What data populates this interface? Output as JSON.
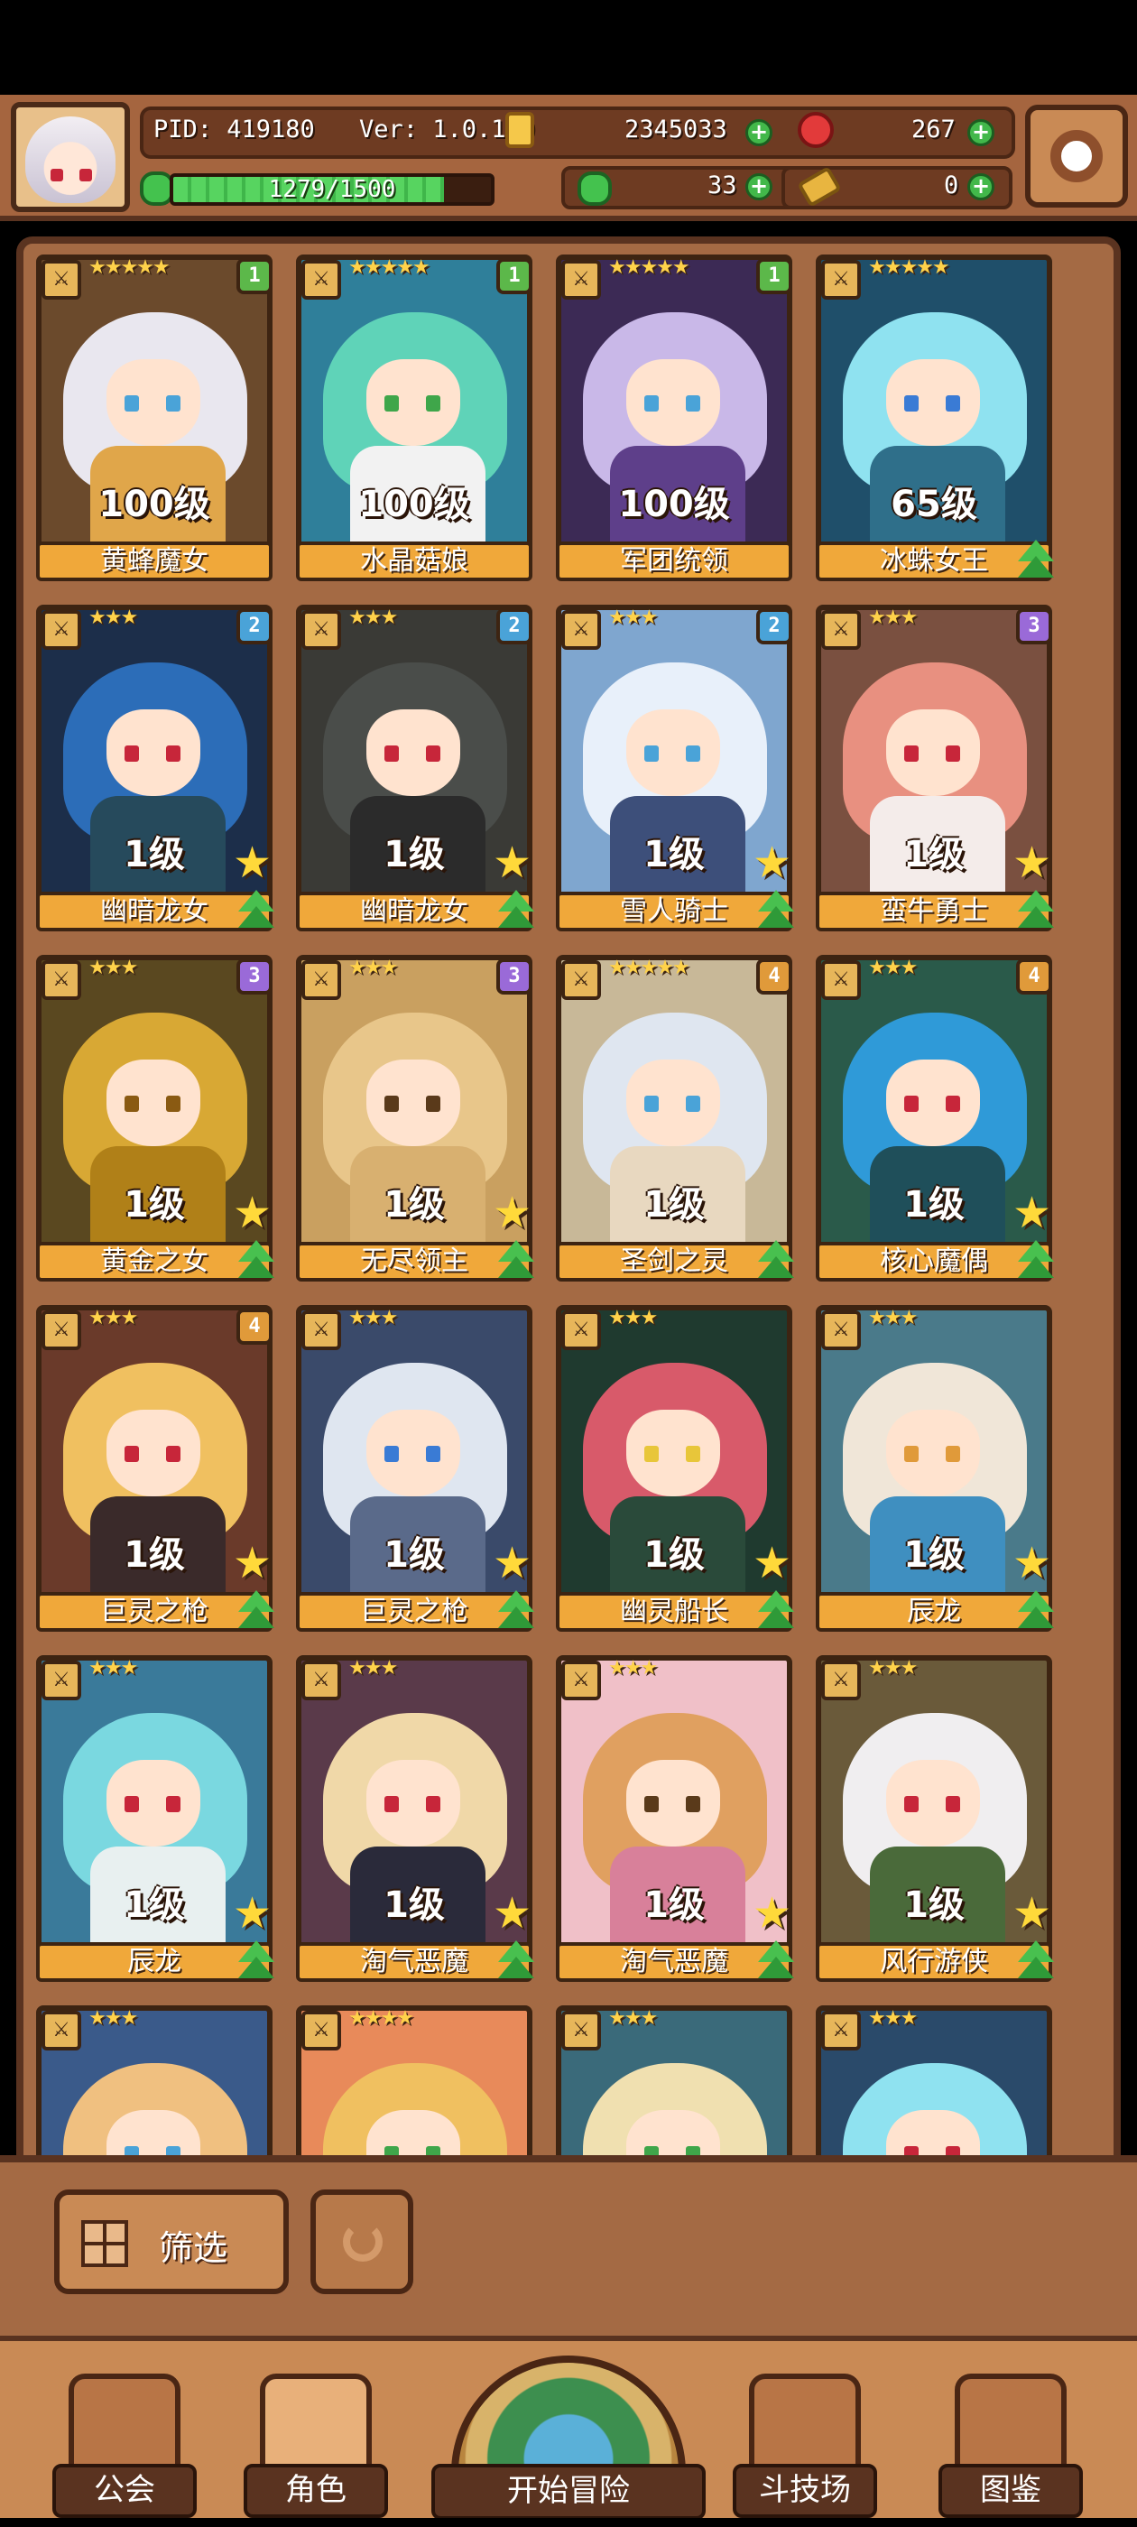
{
  "header": {
    "pid": "PID: 419180",
    "version": "Ver: 1.0.1.0",
    "gold": "2345033",
    "ruby": "267",
    "clover": "33",
    "keys": "0",
    "xp_text": "1279/1500",
    "xp_progress": 0.853
  },
  "cards": [
    {
      "name": "黄蜂魔女",
      "level": "100级",
      "stars": "★★★★★",
      "tier": "1",
      "tier_color": "#5cb84a",
      "hair": "#e9e7ef",
      "body": "#e0a64a",
      "bg": "#6b4a2c",
      "eye": "#4aa3d8",
      "show_star": false,
      "show_arrow": false
    },
    {
      "name": "水晶菇娘",
      "level": "100级",
      "stars": "★★★★★",
      "tier": "1",
      "tier_color": "#5cb84a",
      "hair": "#5fd3b8",
      "body": "#f2f2f2",
      "bg": "#2f7f9a",
      "eye": "#3fa64a",
      "show_star": false,
      "show_arrow": false
    },
    {
      "name": "军团统领",
      "level": "100级",
      "stars": "★★★★★",
      "tier": "1",
      "tier_color": "#5cb84a",
      "hair": "#c9b8e8",
      "body": "#5e3f8a",
      "bg": "#3c2a55",
      "eye": "#4aa3d8",
      "show_star": false,
      "show_arrow": false
    },
    {
      "name": "冰蛛女王",
      "level": "65级",
      "stars": "★★★★★",
      "tier": "",
      "tier_color": "",
      "hair": "#8fe2f0",
      "body": "#2f6f8a",
      "bg": "#1f4f6a",
      "eye": "#3a7bd5",
      "show_star": false,
      "show_arrow": true
    },
    {
      "name": "幽暗龙女",
      "level": "1级",
      "stars": "★★★",
      "tier": "2",
      "tier_color": "#4aa3d8",
      "hair": "#2c6db8",
      "body": "#264a5c",
      "bg": "#1c2e4a",
      "eye": "#c7263a",
      "show_star": true,
      "show_arrow": true
    },
    {
      "name": "幽暗龙女",
      "level": "1级",
      "stars": "★★★",
      "tier": "2",
      "tier_color": "#4aa3d8",
      "hair": "#4a4d4a",
      "body": "#2b2b2b",
      "bg": "#3a3a36",
      "eye": "#c7263a",
      "show_star": true,
      "show_arrow": true
    },
    {
      "name": "雪人骑士",
      "level": "1级",
      "stars": "★★★",
      "tier": "2",
      "tier_color": "#4aa3d8",
      "hair": "#e8f0fa",
      "body": "#3d4f7a",
      "bg": "#7fa6cf",
      "eye": "#4aa3d8",
      "show_star": true,
      "show_arrow": true
    },
    {
      "name": "蛮牛勇士",
      "level": "1级",
      "stars": "★★★",
      "tier": "3",
      "tier_color": "#9a6ad8",
      "hair": "#e89080",
      "body": "#f4ecea",
      "bg": "#7a5040",
      "eye": "#c7263a",
      "show_star": true,
      "show_arrow": true
    },
    {
      "name": "黄金之女",
      "level": "1级",
      "stars": "★★★",
      "tier": "3",
      "tier_color": "#9a6ad8",
      "hair": "#d8a834",
      "body": "#b08018",
      "bg": "#5a4820",
      "eye": "#8a5a12",
      "show_star": true,
      "show_arrow": true
    },
    {
      "name": "无尽领主",
      "level": "1级",
      "stars": "★★★",
      "tier": "3",
      "tier_color": "#9a6ad8",
      "hair": "#e8c68a",
      "body": "#d8b070",
      "bg": "#c9a060",
      "eye": "#5a3a1a",
      "show_star": true,
      "show_arrow": true
    },
    {
      "name": "圣剑之灵",
      "level": "1级",
      "stars": "★★★★★",
      "tier": "4",
      "tier_color": "#e09a3a",
      "hair": "#dfe6f0",
      "body": "#e8d8c0",
      "bg": "#c8b898",
      "eye": "#4aa3d8",
      "show_star": false,
      "show_arrow": true
    },
    {
      "name": "核心魔偶",
      "level": "1级",
      "stars": "★★★",
      "tier": "4",
      "tier_color": "#e09a3a",
      "hair": "#2f9ad8",
      "body": "#1f4f5a",
      "bg": "#2a5a4a",
      "eye": "#c7263a",
      "show_star": true,
      "show_arrow": true
    },
    {
      "name": "巨灵之枪",
      "level": "1级",
      "stars": "★★★",
      "tier": "4",
      "tier_color": "#e09a3a",
      "hair": "#f0c060",
      "body": "#3a2a2a",
      "bg": "#6a3a2a",
      "eye": "#c7263a",
      "show_star": true,
      "show_arrow": true
    },
    {
      "name": "巨灵之枪",
      "level": "1级",
      "stars": "★★★",
      "tier": "",
      "tier_color": "",
      "hair": "#dfe6f0",
      "body": "#5a6a8a",
      "bg": "#3a4a6a",
      "eye": "#3a7bd5",
      "show_star": true,
      "show_arrow": true
    },
    {
      "name": "幽灵船长",
      "level": "1级",
      "stars": "★★★",
      "tier": "",
      "tier_color": "",
      "hair": "#d85a6a",
      "body": "#2a4a3a",
      "bg": "#1f3a2f",
      "eye": "#e8c63a",
      "show_star": true,
      "show_arrow": true
    },
    {
      "name": "辰龙",
      "level": "1级",
      "stars": "★★★",
      "tier": "",
      "tier_color": "",
      "hair": "#f0e6d8",
      "body": "#3f8fc0",
      "bg": "#4a7a8a",
      "eye": "#e09a3a",
      "show_star": true,
      "show_arrow": true
    },
    {
      "name": "辰龙",
      "level": "1级",
      "stars": "★★★",
      "tier": "",
      "tier_color": "",
      "hair": "#7ad8e0",
      "body": "#e8f0f0",
      "bg": "#3a7a9a",
      "eye": "#c7263a",
      "show_star": true,
      "show_arrow": true
    },
    {
      "name": "淘气恶魔",
      "level": "1级",
      "stars": "★★★",
      "tier": "",
      "tier_color": "",
      "hair": "#f0d8a8",
      "body": "#2a2a3a",
      "bg": "#5a3a4a",
      "eye": "#c7263a",
      "show_star": true,
      "show_arrow": true
    },
    {
      "name": "淘气恶魔",
      "level": "1级",
      "stars": "★★★",
      "tier": "",
      "tier_color": "",
      "hair": "#e0a060",
      "body": "#d8809a",
      "bg": "#f0c0c8",
      "eye": "#5a3a1a",
      "show_star": true,
      "show_arrow": true
    },
    {
      "name": "风行游侠",
      "level": "1级",
      "stars": "★★★",
      "tier": "",
      "tier_color": "",
      "hair": "#f0eef0",
      "body": "#4a6a3a",
      "bg": "#6a5a3a",
      "eye": "#c7263a",
      "show_star": true,
      "show_arrow": true
    },
    {
      "name": "",
      "level": "",
      "stars": "★★★",
      "tier": "",
      "tier_color": "",
      "hair": "#f0c080",
      "body": "#c02a3a",
      "bg": "#3a5a8a",
      "eye": "#4aa3d8",
      "show_star": false,
      "show_arrow": false
    },
    {
      "name": "",
      "level": "",
      "stars": "★★★★",
      "tier": "",
      "tier_color": "",
      "hair": "#f0c060",
      "body": "#e0a060",
      "bg": "#e88a5a",
      "eye": "#3fa64a",
      "show_star": false,
      "show_arrow": false
    },
    {
      "name": "",
      "level": "",
      "stars": "★★★",
      "tier": "",
      "tier_color": "",
      "hair": "#f0e0b0",
      "body": "#d8e8c0",
      "bg": "#3a6a7a",
      "eye": "#3fa64a",
      "show_star": false,
      "show_arrow": false
    },
    {
      "name": "",
      "level": "",
      "stars": "★★★",
      "tier": "",
      "tier_color": "",
      "hair": "#8fe2f0",
      "body": "#4a7aa8",
      "bg": "#2a4a6a",
      "eye": "#c7263a",
      "show_star": false,
      "show_arrow": false
    }
  ],
  "filter": {
    "label": "筛选"
  },
  "nav": {
    "guild": "公会",
    "character": "角色",
    "adventure": "开始冒险",
    "arena": "斗技场",
    "codex": "图鉴"
  }
}
